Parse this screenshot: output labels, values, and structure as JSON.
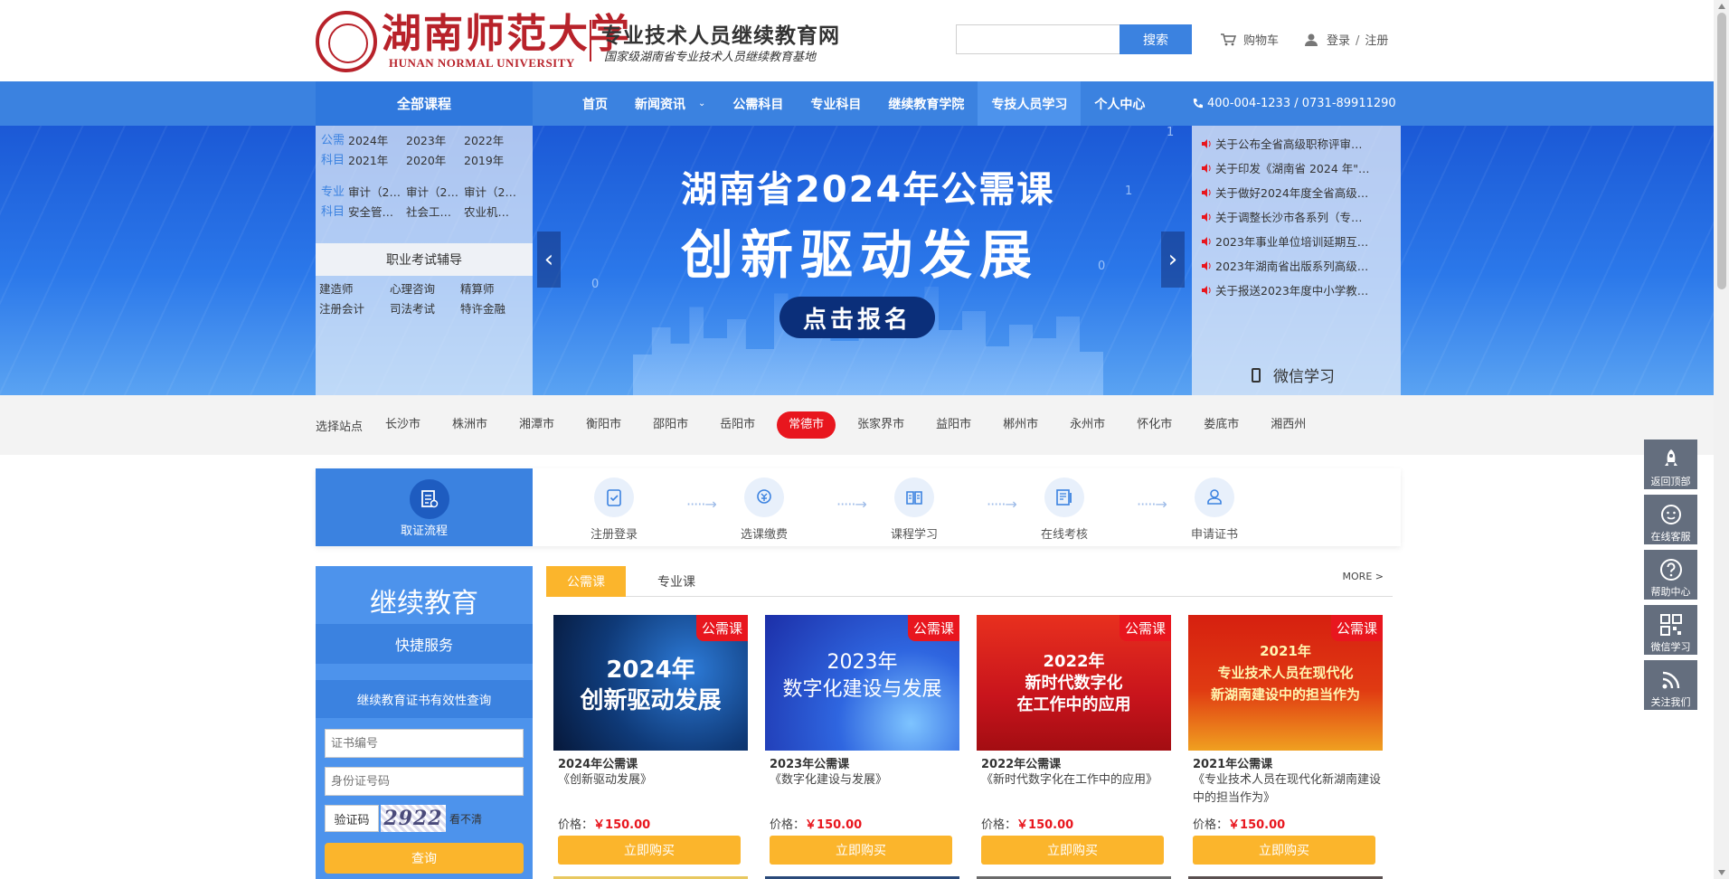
{
  "header": {
    "logo_cn": "湖南师范大学",
    "logo_en": "HUNAN NORMAL UNIVERSITY",
    "site_name": "专业技术人员继续教育网",
    "site_tagline": "国家级湖南省专业技术人员继续教育基地",
    "search_placeholder": "",
    "search_button": "搜索",
    "cart": "购物车",
    "login": "登录",
    "separator": "/",
    "register": "注册"
  },
  "nav": {
    "all_courses": "全部课程",
    "items": [
      {
        "label": "首页"
      },
      {
        "label": "新闻资讯"
      },
      {
        "label": "公需科目"
      },
      {
        "label": "专业科目"
      },
      {
        "label": "继续教育学院"
      },
      {
        "label": "专技人员学习"
      },
      {
        "label": "个人中心"
      }
    ],
    "dropdown_caret": "⌄",
    "phone": "400-004-1233  /  0731-89911290"
  },
  "categories": {
    "public": {
      "label": "公需科目",
      "links": [
        "2024年",
        "2023年",
        "2022年",
        "2021年",
        "2020年",
        "2019年"
      ]
    },
    "professional": {
      "label": "专业科目",
      "links": [
        "审计（2…",
        "审计（2…",
        "审计（2…",
        "安全管…",
        "社会工…",
        "农业机…"
      ]
    },
    "exam_heading": "职业考试辅导",
    "exam_links": [
      "建造师",
      "心理咨询",
      "精算师",
      "注册会计",
      "司法考试",
      "特许金融"
    ]
  },
  "banner": {
    "title_line1": "湖南省2024年公需课",
    "title_line2": "创新驱动发展",
    "cta": "点击报名",
    "prev": "‹",
    "next": "›",
    "deco_digits": [
      "0",
      "1",
      "0",
      "1",
      "0"
    ]
  },
  "news": {
    "items": [
      "关于公布全省高级职称评审…",
      "关于印发《湖南省 2024 年\"…",
      "关于做好2024年度全省高级…",
      "关于调整长沙市各系列（专…",
      "2023年事业单位培训延期互…",
      "2023年湖南省出版系列高级…",
      "关于报送2023年度中小学教…"
    ],
    "wechat_learning": "微信学习"
  },
  "city_bar": {
    "label": "选择站点",
    "cities": [
      "长沙市",
      "株洲市",
      "湘潭市",
      "衡阳市",
      "邵阳市",
      "岳阳市",
      "常德市",
      "张家界市",
      "益阳市",
      "郴州市",
      "永州市",
      "怀化市",
      "娄底市",
      "湘西州"
    ],
    "active": "常德市"
  },
  "process": {
    "heading": "取证流程",
    "steps": [
      "注册登录",
      "选课缴费",
      "课程学习",
      "在线考核",
      "申请证书"
    ],
    "arrow": "·····→"
  },
  "sidebar": {
    "title": "继续教育",
    "quick_service": "快捷服务",
    "cert_query_heading": "继续教育证书有效性查询",
    "cert_no_placeholder": "证书编号",
    "id_no_placeholder": "身份证号码",
    "captcha_label": "验证码",
    "captcha_code": "2922",
    "captcha_refresh": "看不清",
    "query_button": "查询"
  },
  "courses": {
    "tabs": [
      "公需课",
      "专业课"
    ],
    "more": "MORE >",
    "price_label": "价格：",
    "currency": "￥",
    "buy_label": "立即购买",
    "items": [
      {
        "badge": "公需课",
        "image_text": "2024年\n创新驱动发展",
        "title": "2024年公需课",
        "desc": "《创新驱动发展》",
        "price": "150.00",
        "bg": "#0f3a78"
      },
      {
        "badge": "公需课",
        "image_text": "2023年\n数字化建设与发展",
        "title": "2023年公需课",
        "desc": "《数字化建设与发展》",
        "price": "150.00",
        "bg": "#1c49c8"
      },
      {
        "badge": "公需课",
        "image_text": "2022年\n新时代数字化\n在工作中的应用",
        "title": "2022年公需课",
        "desc": "《新时代数字化在工作中的应用》",
        "price": "150.00",
        "bg": "#c8141c"
      },
      {
        "badge": "公需课",
        "image_text": "2021年\n专业技术人员在现代化\n新湖南建设中的担当作为",
        "title": "2021年公需课",
        "desc": "《专业技术人员在现代化新湖南建设中的担当作为》",
        "price": "150.00",
        "bg": "#d62010"
      }
    ]
  },
  "side_tools": [
    "返回顶部",
    "在线客服",
    "帮助中心",
    "微信学习",
    "关注我们"
  ],
  "colors": {
    "primary_blue": "#3b82e0",
    "accent_orange": "#fbb52c",
    "accent_red": "#e8161e",
    "brand_red": "#b8222a"
  }
}
